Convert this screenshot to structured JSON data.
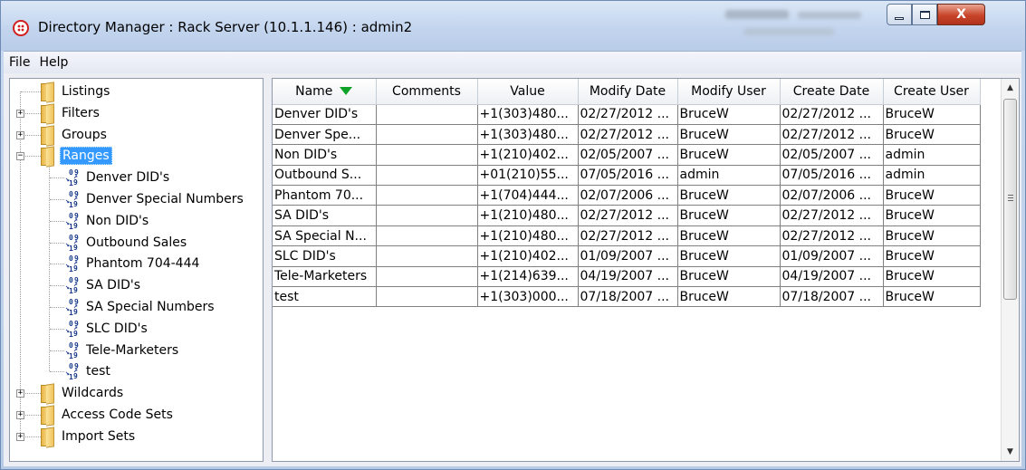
{
  "window": {
    "title": "Directory Manager : Rack Server (10.1.1.146) : admin2",
    "close_glyph": "X"
  },
  "menubar": {
    "file": "File",
    "help": "Help"
  },
  "tree": {
    "nodes": [
      {
        "label": "Listings",
        "type": "folder",
        "expandable": false
      },
      {
        "label": "Filters",
        "type": "folder",
        "expandable": true,
        "state": "+"
      },
      {
        "label": "Groups",
        "type": "folder",
        "expandable": true,
        "state": "+"
      },
      {
        "label": "Ranges",
        "type": "folder",
        "expandable": true,
        "state": "−",
        "selected": true
      },
      {
        "label": "Denver DID's",
        "type": "range"
      },
      {
        "label": "Denver Special Numbers",
        "type": "range"
      },
      {
        "label": "Non DID's",
        "type": "range"
      },
      {
        "label": "Outbound Sales",
        "type": "range"
      },
      {
        "label": "Phantom 704-444",
        "type": "range"
      },
      {
        "label": "SA DID's",
        "type": "range"
      },
      {
        "label": "SA Special Numbers",
        "type": "range"
      },
      {
        "label": "SLC DID's",
        "type": "range"
      },
      {
        "label": "Tele-Marketers",
        "type": "range"
      },
      {
        "label": "test",
        "type": "range"
      },
      {
        "label": "Wildcards",
        "type": "folder",
        "expandable": true,
        "state": "+"
      },
      {
        "label": "Access Code Sets",
        "type": "folder",
        "expandable": true,
        "state": "+"
      },
      {
        "label": "Import Sets",
        "type": "folder",
        "expandable": true,
        "state": "+"
      }
    ]
  },
  "table": {
    "sort_column": "Name",
    "sort_direction": "descending",
    "sort_arrow_color": "#0ea328",
    "columns": [
      "Name",
      "Comments",
      "Value",
      "Modify Date",
      "Modify User",
      "Create Date",
      "Create User"
    ],
    "rows": [
      [
        "Denver DID's",
        "",
        "+1(303)480...",
        "02/27/2012 ...",
        "BruceW",
        "02/27/2012 ...",
        "BruceW"
      ],
      [
        "Denver Spe...",
        "",
        "+1(303)480...",
        "02/27/2012 ...",
        "BruceW",
        "02/27/2012 ...",
        "BruceW"
      ],
      [
        "Non DID's",
        "",
        "+1(210)402...",
        "02/05/2007 ...",
        "BruceW",
        "02/05/2007 ...",
        "admin"
      ],
      [
        "Outbound S...",
        "",
        "+01(210)55...",
        "07/05/2016 ...",
        "admin",
        "07/05/2016 ...",
        "admin"
      ],
      [
        "Phantom 70...",
        "",
        "+1(704)444...",
        "02/07/2006 ...",
        "BruceW",
        "02/07/2006 ...",
        "BruceW"
      ],
      [
        "SA DID's",
        "",
        "+1(210)480...",
        "02/27/2012 ...",
        "BruceW",
        "02/27/2012 ...",
        "BruceW"
      ],
      [
        "SA Special N...",
        "",
        "+1(210)480...",
        "02/27/2012 ...",
        "BruceW",
        "02/27/2012 ...",
        "BruceW"
      ],
      [
        "SLC DID's",
        "",
        "+1(210)402...",
        "01/09/2007 ...",
        "BruceW",
        "01/09/2007 ...",
        "BruceW"
      ],
      [
        "Tele-Marketers",
        "",
        "+1(214)639...",
        "04/19/2007 ...",
        "BruceW",
        "04/19/2007 ...",
        "BruceW"
      ],
      [
        "test",
        "",
        "+1(303)000...",
        "07/18/2007 ...",
        "BruceW",
        "07/18/2007 ...",
        "BruceW"
      ]
    ]
  },
  "colors": {
    "selection": "#3399ff",
    "close_button": "#c8442a"
  }
}
